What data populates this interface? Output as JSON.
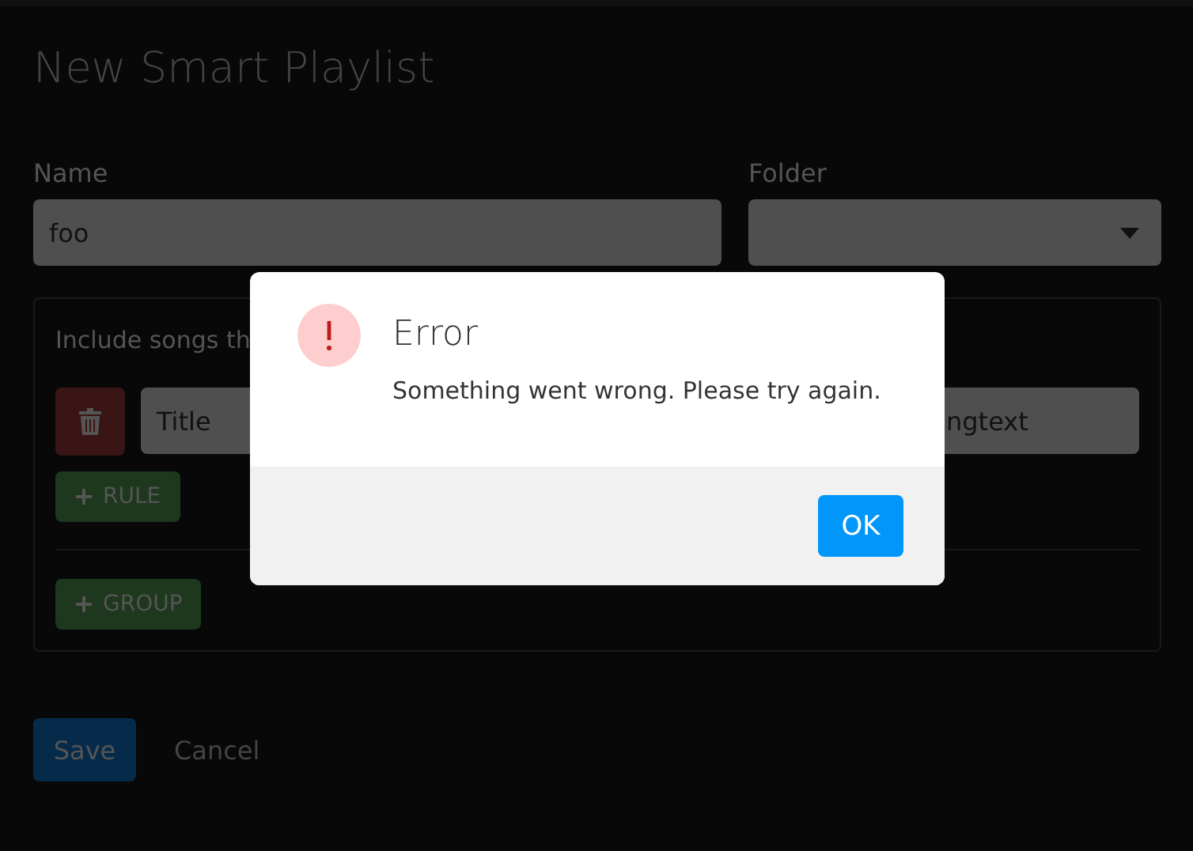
{
  "page": {
    "title": "New Smart Playlist"
  },
  "form": {
    "name_label": "Name",
    "name_value": "foo",
    "folder_label": "Folder",
    "rules_intro": "Include songs th",
    "rules": [
      {
        "field": "Title",
        "value": "ngtext"
      }
    ],
    "add_rule": "RULE",
    "add_group": "GROUP"
  },
  "actions": {
    "save": "Save",
    "cancel": "Cancel"
  },
  "dialog": {
    "title": "Error",
    "message": "Something went wrong. Please try again.",
    "button": "OK"
  }
}
